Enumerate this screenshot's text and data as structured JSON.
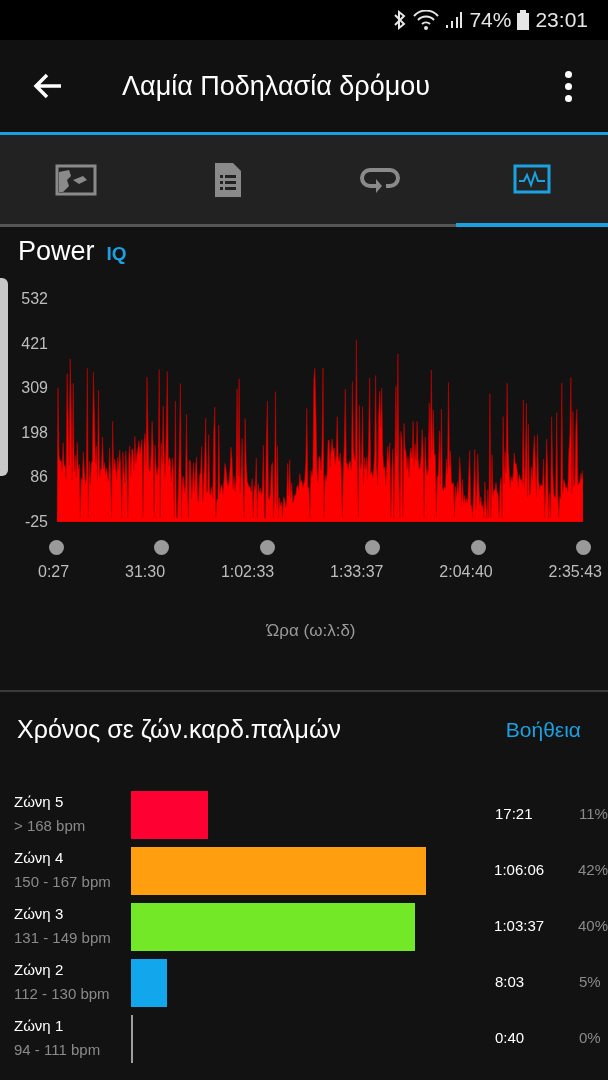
{
  "status_bar": {
    "battery": "74%",
    "time": "23:01"
  },
  "header": {
    "title": "Λαμία Ποδηλασία δρόμου"
  },
  "tabs": [
    {
      "kind": "map",
      "selected": false
    },
    {
      "kind": "details",
      "selected": false
    },
    {
      "kind": "laps",
      "selected": false
    },
    {
      "kind": "chart",
      "selected": true
    }
  ],
  "power": {
    "title": "Power",
    "badge": "IQ",
    "y_labels": [
      "532",
      "421",
      "309",
      "198",
      "86",
      "-25"
    ],
    "x_labels": [
      "0:27",
      "31:30",
      "1:02:33",
      "1:33:37",
      "2:04:40",
      "2:35:43"
    ],
    "axis_title": "Ώρα (ω:λ:δ)"
  },
  "zones_section": {
    "title": "Χρόνος σε ζών.καρδ.παλμών",
    "help_link": "Βοήθεια"
  },
  "zones": [
    {
      "name": "Ζώνη 5",
      "range": "> 168 bpm",
      "color": "#ff0033",
      "time": "17:21",
      "percent": "11%"
    },
    {
      "name": "Ζώνη 4",
      "range": "150 - 167 bpm",
      "color": "#ff9f10",
      "time": "1:06:06",
      "percent": "42%"
    },
    {
      "name": "Ζώνη 3",
      "range": "131 - 149 bpm",
      "color": "#72e827",
      "time": "1:03:37",
      "percent": "40%"
    },
    {
      "name": "Ζώνη 2",
      "range": "112 - 130 bpm",
      "color": "#12a6ec",
      "time": "8:03",
      "percent": "5%"
    },
    {
      "name": "Ζώνη 1",
      "range": "94 - 111 bpm",
      "color": "#9e9e9e",
      "time": "0:40",
      "percent": "0%"
    }
  ]
}
